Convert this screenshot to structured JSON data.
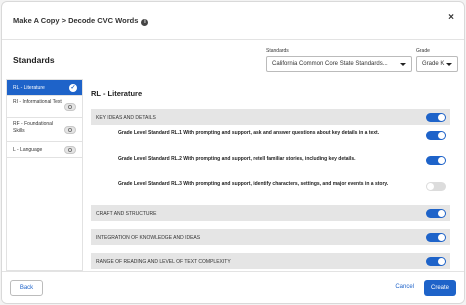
{
  "modal": {
    "title": "Make A Copy > Decode CVC Words",
    "close_label": "×"
  },
  "standards_heading": "Standards",
  "filters": {
    "standards_label": "Standards",
    "standards_value": "California Common Core State Standards...",
    "grade_label": "Grade",
    "grade_value": "Grade K"
  },
  "sidebar": {
    "items": [
      {
        "label": "RL - Literature",
        "active": true
      },
      {
        "label": "RI - Informational Text",
        "active": false
      },
      {
        "label": "RF - Foundational Skills",
        "active": false
      },
      {
        "label": "L - Language",
        "active": false
      }
    ]
  },
  "content": {
    "title": "RL - Literature",
    "sections": [
      {
        "label": "KEY IDEAS AND DETAILS",
        "on": true
      },
      {
        "label": "CRAFT AND STRUCTURE",
        "on": true
      },
      {
        "label": "INTEGRATION OF KNOWLEDGE AND IDEAS",
        "on": true
      },
      {
        "label": "RANGE OF READING AND LEVEL OF TEXT COMPLEXITY",
        "on": true
      }
    ],
    "standards": [
      {
        "text": "Grade Level Standard RL.1 With prompting and support, ask and answer questions about key details in a text.",
        "on": true
      },
      {
        "text": "Grade Level Standard RL.2 With prompting and support, retell familiar stories, including key details.",
        "on": true
      },
      {
        "text": "Grade Level Standard RL.3 With prompting and support, identify characters, settings, and major events in a story.",
        "on": false
      }
    ]
  },
  "footer": {
    "back_label": "Back",
    "cancel_label": "Cancel",
    "create_label": "Create"
  },
  "colors": {
    "accent": "#1e63c9",
    "section_bg": "#e5e5e5"
  }
}
